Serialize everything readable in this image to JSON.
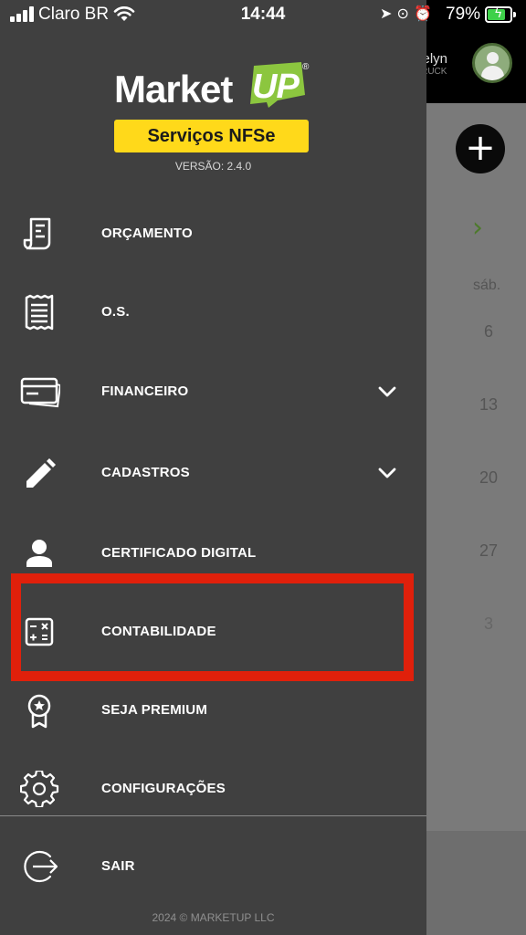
{
  "status_bar": {
    "carrier": "Claro BR",
    "time": "14:44",
    "battery_percent": "79%",
    "battery_level": 0.79
  },
  "background": {
    "user_name": "velyn",
    "user_sub": "TRUCK",
    "day_label": "sáb.",
    "dates": [
      "6",
      "13",
      "20",
      "27",
      "3"
    ]
  },
  "drawer": {
    "logo_text_main": "Market",
    "logo_text_up": "UP",
    "logo_registered": "®",
    "badge": "Serviços NFSe",
    "version": "VERSÃO: 2.4.0",
    "items": [
      {
        "label": "ORÇAMENTO",
        "icon": "receipt-icon"
      },
      {
        "label": "O.S.",
        "icon": "document-list-icon"
      },
      {
        "label": "FINANCEIRO",
        "icon": "credit-card-icon",
        "expandable": true
      },
      {
        "label": "CADASTROS",
        "icon": "pencil-icon",
        "expandable": true
      },
      {
        "label": "CERTIFICADO DIGITAL",
        "icon": "person-icon"
      },
      {
        "label": "CONTABILIDADE",
        "icon": "calculator-icon"
      },
      {
        "label": "SEJA PREMIUM",
        "icon": "award-star-icon"
      },
      {
        "label": "CONFIGURAÇÕES",
        "icon": "gear-icon"
      },
      {
        "label": "SAIR",
        "icon": "logout-icon"
      }
    ],
    "footer": "2024 © MARKETUP LLC"
  },
  "colors": {
    "drawer_bg": "#404040",
    "badge_bg": "#ffd91a",
    "logo_green": "#8cc63f",
    "highlight": "#e0200b"
  }
}
